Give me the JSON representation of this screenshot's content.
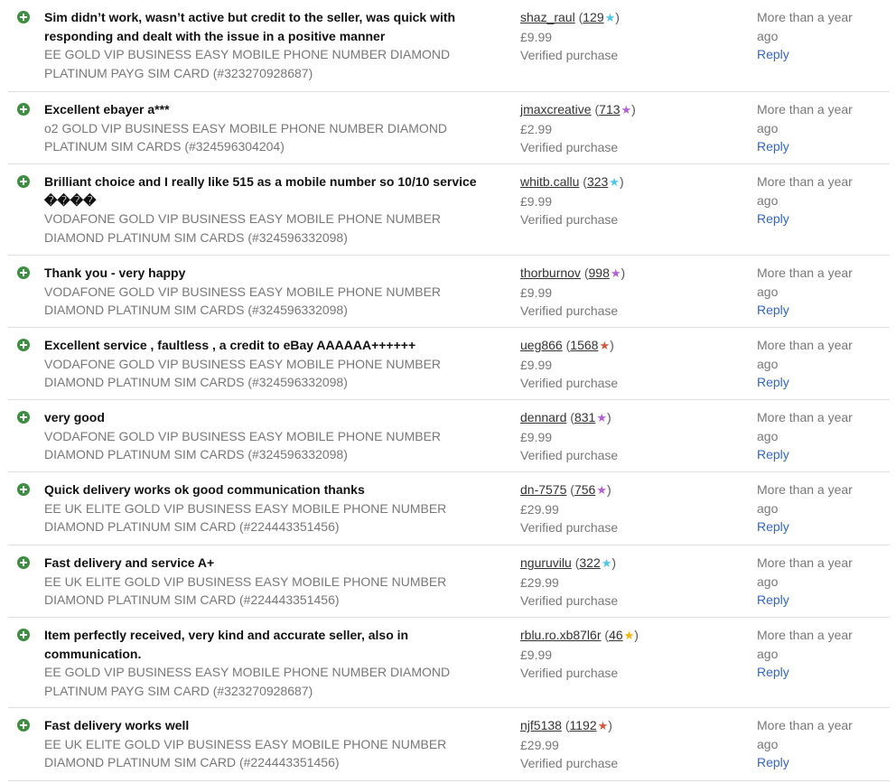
{
  "colors": {
    "positive_icon": "#3e8e41",
    "star_turquoise": "#4fc6e8",
    "star_purple": "#b260d6",
    "star_red": "#d9553c",
    "star_yellow": "#f4b400",
    "link_blue": "#3365c4"
  },
  "icons": {
    "positive": "positive-feedback-plus-icon",
    "star": "star-icon"
  },
  "rows": [
    {
      "comment": "Sim didn’t work, wasn’t active but credit to the seller, was quick with responding and dealt with the issue in a positive manner",
      "item": "EE GOLD VIP BUSINESS EASY MOBILE PHONE NUMBER DIAMOND PLATINUM PAYG SIM CARD (#323270928687)",
      "username": "shaz_raul",
      "score": "129",
      "star_color": "#4fc6e8",
      "price": "£9.99",
      "verified": "Verified purchase",
      "time": "More than a year ago",
      "reply": "Reply"
    },
    {
      "comment": "Excellent ebayer a***",
      "item": "o2 GOLD VIP BUSINESS EASY MOBILE PHONE NUMBER DIAMOND PLATINUM SIM CARDS (#324596304204)",
      "username": "jmaxcreative",
      "score": "713",
      "star_color": "#b260d6",
      "price": "£2.99",
      "verified": "Verified purchase",
      "time": "More than a year ago",
      "reply": "Reply"
    },
    {
      "comment": "Brilliant choice and I really like 515 as a mobile number so 10/10 service ����",
      "item": "VODAFONE GOLD VIP BUSINESS EASY MOBILE PHONE NUMBER DIAMOND PLATINUM SIM CARDS (#324596332098)",
      "username": "whitb.callu",
      "score": "323",
      "star_color": "#4fc6e8",
      "price": "£9.99",
      "verified": "Verified purchase",
      "time": "More than a year ago",
      "reply": "Reply"
    },
    {
      "comment": "Thank you - very happy",
      "item": "VODAFONE GOLD VIP BUSINESS EASY MOBILE PHONE NUMBER DIAMOND PLATINUM SIM CARDS (#324596332098)",
      "username": "thorburnov",
      "score": "998",
      "star_color": "#b260d6",
      "price": "£9.99",
      "verified": "Verified purchase",
      "time": "More than a year ago",
      "reply": "Reply"
    },
    {
      "comment": "Excellent service , faultless , a credit to eBay AAAAAA++++++",
      "item": "VODAFONE GOLD VIP BUSINESS EASY MOBILE PHONE NUMBER DIAMOND PLATINUM SIM CARDS (#324596332098)",
      "username": "ueg866",
      "score": "1568",
      "star_color": "#d9553c",
      "price": "£9.99",
      "verified": "Verified purchase",
      "time": "More than a year ago",
      "reply": "Reply"
    },
    {
      "comment": "very good",
      "item": "VODAFONE GOLD VIP BUSINESS EASY MOBILE PHONE NUMBER DIAMOND PLATINUM SIM CARDS (#324596332098)",
      "username": "dennard",
      "score": "831",
      "star_color": "#b260d6",
      "price": "£9.99",
      "verified": "Verified purchase",
      "time": "More than a year ago",
      "reply": "Reply"
    },
    {
      "comment": "Quick delivery works ok good communication thanks",
      "item": "EE UK ELITE GOLD VIP BUSINESS EASY MOBILE PHONE NUMBER DIAMOND PLATINUM SIM CARD (#224443351456)",
      "username": "dn-7575",
      "score": "756",
      "star_color": "#b260d6",
      "price": "£29.99",
      "verified": "Verified purchase",
      "time": "More than a year ago",
      "reply": "Reply"
    },
    {
      "comment": "Fast delivery and service A+",
      "item": "EE UK ELITE GOLD VIP BUSINESS EASY MOBILE PHONE NUMBER DIAMOND PLATINUM SIM CARD (#224443351456)",
      "username": "nguruvilu",
      "score": "322",
      "star_color": "#4fc6e8",
      "price": "£29.99",
      "verified": "Verified purchase",
      "time": "More than a year ago",
      "reply": "Reply"
    },
    {
      "comment": "Item perfectly received, very kind and accurate seller, also in communication.",
      "item": "EE GOLD VIP BUSINESS EASY MOBILE PHONE NUMBER DIAMOND PLATINUM PAYG SIM CARD (#323270928687)",
      "username": "rblu.ro.xb87l6r",
      "score": "46",
      "star_color": "#f4b400",
      "price": "£9.99",
      "verified": "Verified purchase",
      "time": "More than a year ago",
      "reply": "Reply"
    },
    {
      "comment": "Fast delivery works well",
      "item": "EE UK ELITE GOLD VIP BUSINESS EASY MOBILE PHONE NUMBER DIAMOND PLATINUM SIM CARD (#224443351456)",
      "username": "njf5138",
      "score": "1192",
      "star_color": "#d9553c",
      "price": "£29.99",
      "verified": "Verified purchase",
      "time": "More than a year ago",
      "reply": "Reply"
    }
  ]
}
